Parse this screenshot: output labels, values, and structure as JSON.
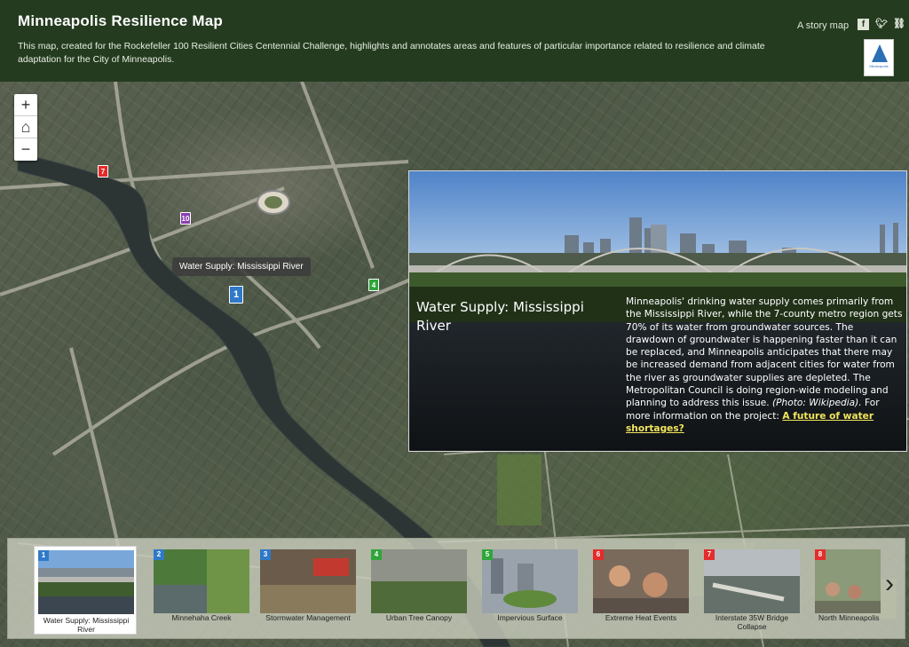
{
  "header": {
    "title": "Minneapolis Resilience Map",
    "subtitle": "This map, created for the Rockefeller 100 Resilient Cities Centennial Challenge, highlights and annotates areas and features of particular importance related to resilience and climate adaptation for the City of Minneapolis.",
    "story_label": "A story map",
    "share_icons": [
      "facebook-icon",
      "twitter-icon",
      "link-icon"
    ],
    "logo_text": "Minneapolis City of Lakes"
  },
  "map": {
    "zoom_in": "+",
    "home_icon": "⌂",
    "zoom_out": "−",
    "tooltip": "Water Supply: Mississippi River",
    "pins": [
      {
        "label": "7",
        "color": "#e52b2b"
      },
      {
        "label": "10",
        "color": "#8a3fb0"
      },
      {
        "label": "4",
        "color": "#2fa63a"
      },
      {
        "label": "1",
        "color": "#2f79c9"
      }
    ]
  },
  "panel": {
    "title": "Water Supply: Mississippi River",
    "body": "Minneapolis' drinking water supply comes primarily from the Mississippi River, while the 7-county metro region gets 70% of its water from groundwater sources. The drawdown of groundwater is happening faster than it can be replaced, and Minneapolis anticipates that there may be increased demand from adjacent cities for water from the river as groundwater supplies are depleted. The Metropolitan Council is doing region-wide modeling and planning to address this issue.",
    "photo_credit": "(Photo: Wikipedia).",
    "more_info": "For more information on the project:",
    "link_text": "A future of water shortages?"
  },
  "carousel": {
    "next_icon": "›",
    "items": [
      {
        "num": "1",
        "label": "Water Supply: Mississippi River",
        "color": "#2f79c9"
      },
      {
        "num": "2",
        "label": "Minnehaha Creek",
        "color": "#2f79c9"
      },
      {
        "num": "3",
        "label": "Stormwater Management",
        "color": "#2f79c9"
      },
      {
        "num": "4",
        "label": "Urban Tree Canopy",
        "color": "#2fa63a"
      },
      {
        "num": "5",
        "label": "Impervious Surface",
        "color": "#2fa63a"
      },
      {
        "num": "6",
        "label": "Extreme Heat Events",
        "color": "#e52b2b"
      },
      {
        "num": "7",
        "label": "Interstate 35W Bridge Collapse",
        "color": "#e52b2b"
      },
      {
        "num": "8",
        "label": "North Minneapolis",
        "color": "#e52b2b"
      }
    ]
  }
}
